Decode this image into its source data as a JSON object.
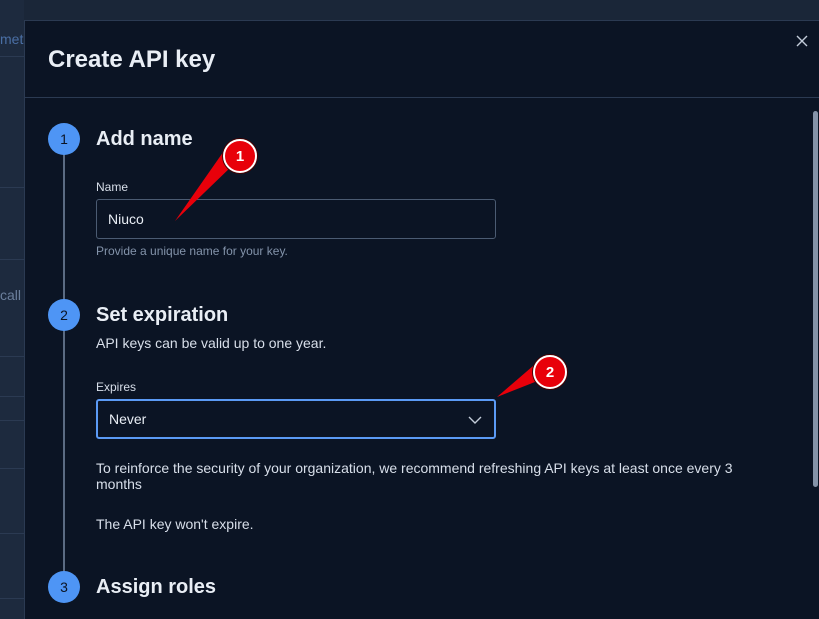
{
  "background": {
    "fragments": [
      "met",
      "call"
    ]
  },
  "modal": {
    "title": "Create API key",
    "close_icon": "close-icon"
  },
  "steps": [
    {
      "number": "1",
      "title": "Add name",
      "field_label": "Name",
      "value": "Niuco",
      "helper": "Provide a unique name for your key."
    },
    {
      "number": "2",
      "title": "Set expiration",
      "description": "API keys can be valid up to one year.",
      "field_label": "Expires",
      "selected": "Never",
      "recommendation": "To reinforce the security of your organization, we recommend refreshing API keys at least once every 3 months",
      "status": "The API key won't expire."
    },
    {
      "number": "3",
      "title": "Assign roles"
    }
  ],
  "annotations": [
    "1",
    "2"
  ],
  "colors": {
    "accent": "#4e95f5",
    "marker": "#e8000a"
  }
}
